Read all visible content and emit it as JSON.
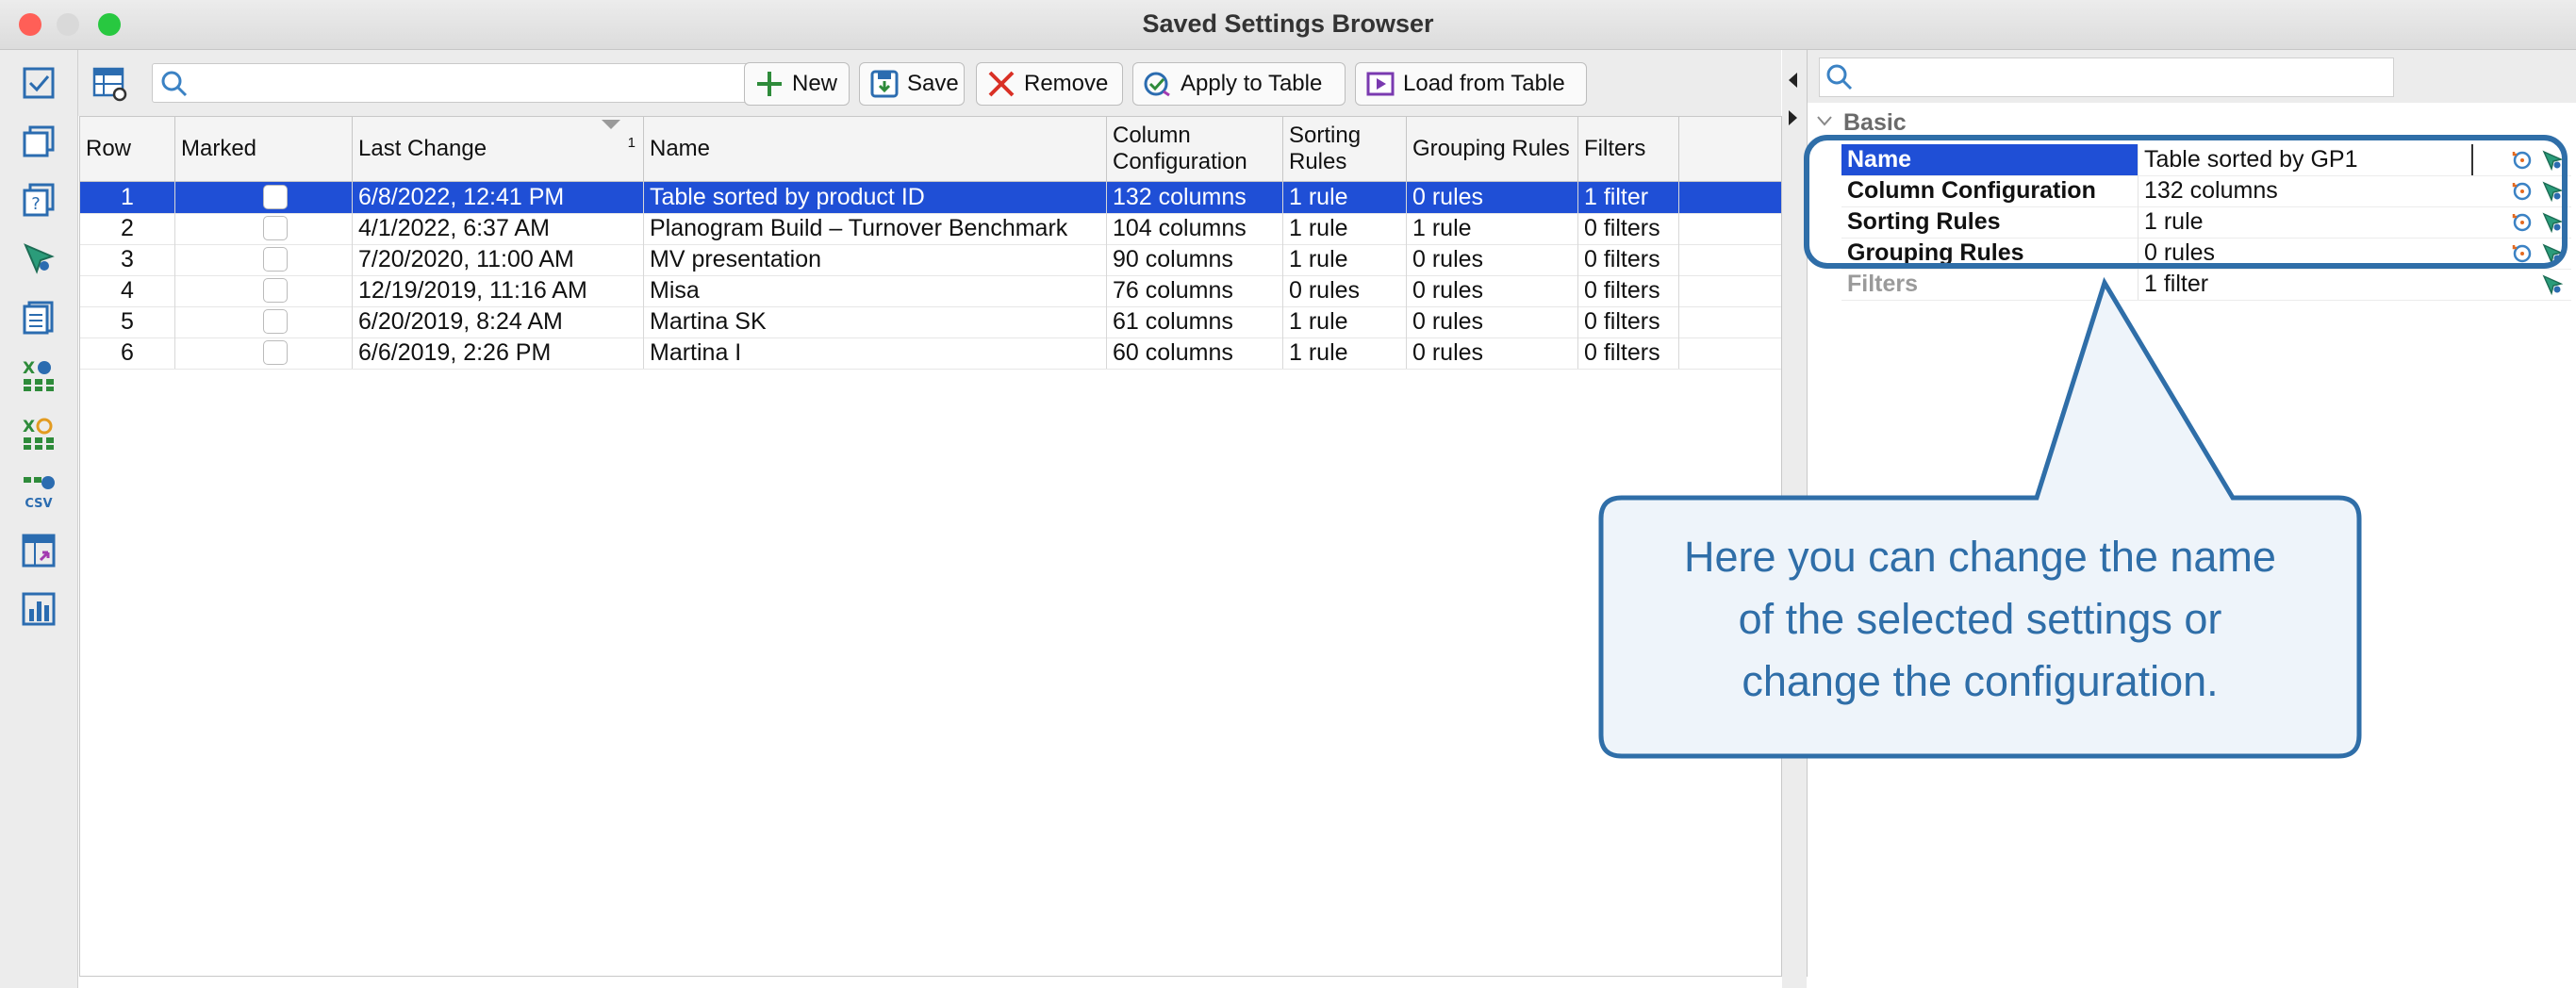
{
  "window": {
    "title": "Saved Settings Browser",
    "traffic_lights": [
      {
        "name": "close",
        "color": "#ff5f57"
      },
      {
        "name": "minimize",
        "color": "#d9d9d9"
      },
      {
        "name": "zoom",
        "color": "#28c840"
      }
    ]
  },
  "toolbar": {
    "search_placeholder": "",
    "buttons": {
      "new": "New",
      "save": "Save",
      "remove": "Remove",
      "apply": "Apply to Table",
      "load": "Load from Table"
    }
  },
  "table": {
    "columns": {
      "row": "Row",
      "marked": "Marked",
      "last_change": "Last Change",
      "last_change_sort": "1",
      "name": "Name",
      "column_configuration": "Column Configuration",
      "sorting_rules": "Sorting Rules",
      "grouping_rules": "Grouping Rules",
      "filters": "Filters"
    },
    "rows": [
      {
        "row": "1",
        "marked": false,
        "last_change": "6/8/2022, 12:41 PM",
        "name": "Table sorted by product ID",
        "columns": "132 columns",
        "sorting": "1 rule",
        "grouping": "0 rules",
        "filters": "1 filter",
        "selected": true
      },
      {
        "row": "2",
        "marked": false,
        "last_change": "4/1/2022, 6:37 AM",
        "name": "Planogram Build – Turnover Benchmark",
        "columns": "104 columns",
        "sorting": "1 rule",
        "grouping": "1 rule",
        "filters": "0 filters",
        "selected": false
      },
      {
        "row": "3",
        "marked": false,
        "last_change": "7/20/2020, 11:00 AM",
        "name": "MV presentation",
        "columns": "90 columns",
        "sorting": "1 rule",
        "grouping": "0 rules",
        "filters": "0 filters",
        "selected": false
      },
      {
        "row": "4",
        "marked": false,
        "last_change": "12/19/2019, 11:16 AM",
        "name": "Misa",
        "columns": "76 columns",
        "sorting": "0 rules",
        "grouping": "0 rules",
        "filters": "0 filters",
        "selected": false
      },
      {
        "row": "5",
        "marked": false,
        "last_change": "6/20/2019, 8:24 AM",
        "name": "Martina SK",
        "columns": "61 columns",
        "sorting": "1 rule",
        "grouping": "0 rules",
        "filters": "0 filters",
        "selected": false
      },
      {
        "row": "6",
        "marked": false,
        "last_change": "6/6/2019, 2:26 PM",
        "name": "Martina I",
        "columns": "60 columns",
        "sorting": "1 rule",
        "grouping": "0 rules",
        "filters": "0 filters",
        "selected": false
      }
    ]
  },
  "properties": {
    "group": "Basic",
    "rows": [
      {
        "label": "Name",
        "value": "Table sorted by GP1",
        "selected": true,
        "enabled": true
      },
      {
        "label": "Column Configuration",
        "value": "132 columns",
        "selected": false,
        "enabled": true
      },
      {
        "label": "Sorting Rules",
        "value": "1 rule",
        "selected": false,
        "enabled": true
      },
      {
        "label": "Grouping Rules",
        "value": "0 rules",
        "selected": false,
        "enabled": true
      },
      {
        "label": "Filters",
        "value": "1 filter",
        "selected": false,
        "enabled": false
      }
    ]
  },
  "callout": {
    "text_line1": "Here you can change the name",
    "text_line2": "of the selected settings or",
    "text_line3": "change the configuration.",
    "color": "#2f6ea8",
    "fill": "#eef4fa"
  },
  "colors": {
    "selection": "#1f4fd6",
    "accent": "#2f6ea8"
  }
}
